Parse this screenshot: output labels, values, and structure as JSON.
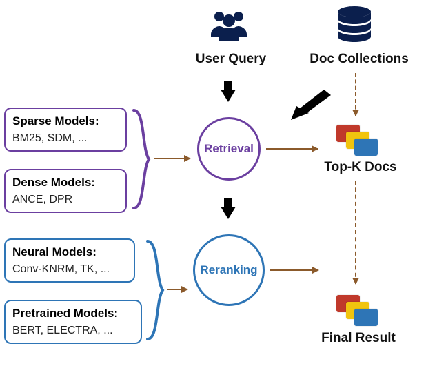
{
  "diagram": {
    "top": {
      "user_query_label": "User Query",
      "doc_collections_label": "Doc Collections"
    },
    "stages": {
      "retrieval": "Retrieval",
      "reranking": "Reranking"
    },
    "outputs": {
      "topk": "Top-K Docs",
      "final": "Final Result"
    },
    "models": {
      "sparse": {
        "title": "Sparse Models:",
        "items": "BM25, SDM, ..."
      },
      "dense": {
        "title": "Dense Models:",
        "items": "ANCE, DPR"
      },
      "neural": {
        "title": "Neural Models:",
        "items": "Conv-KNRM, TK, ..."
      },
      "pretrained": {
        "title": "Pretrained Models:",
        "items": "BERT, ELECTRA, ..."
      }
    },
    "icons": {
      "people": "people-icon",
      "database": "database-icon",
      "doc_stack": "doc-stack"
    },
    "colors": {
      "purple": "#6b3fa0",
      "blue": "#2e75b6",
      "brown": "#8b5a2b",
      "doc_red": "#c0392b",
      "doc_yellow": "#f1c40f",
      "doc_blue": "#2e75b6",
      "db_navy": "#0b1f4d"
    }
  },
  "chart_data": {
    "type": "diagram",
    "title": "",
    "nodes": [
      {
        "id": "user_query",
        "label": "User Query",
        "kind": "source"
      },
      {
        "id": "doc_collections",
        "label": "Doc Collections",
        "kind": "source"
      },
      {
        "id": "retrieval",
        "label": "Retrieval",
        "kind": "stage",
        "color": "purple"
      },
      {
        "id": "reranking",
        "label": "Reranking",
        "kind": "stage",
        "color": "blue"
      },
      {
        "id": "topk",
        "label": "Top-K Docs",
        "kind": "output"
      },
      {
        "id": "final",
        "label": "Final Result",
        "kind": "output"
      },
      {
        "id": "sparse_models",
        "label": "Sparse Models: BM25, SDM, ...",
        "kind": "model-group",
        "color": "purple"
      },
      {
        "id": "dense_models",
        "label": "Dense Models: ANCE, DPR",
        "kind": "model-group",
        "color": "purple"
      },
      {
        "id": "neural_models",
        "label": "Neural Models: Conv-KNRM, TK, ...",
        "kind": "model-group",
        "color": "blue"
      },
      {
        "id": "pretrained_models",
        "label": "Pretrained Models: BERT, ELECTRA, ...",
        "kind": "model-group",
        "color": "blue"
      }
    ],
    "edges": [
      {
        "from": "user_query",
        "to": "retrieval",
        "style": "solid-thick"
      },
      {
        "from": "doc_collections",
        "to": "retrieval",
        "style": "solid-thick"
      },
      {
        "from": "doc_collections",
        "to": "topk",
        "style": "dashed"
      },
      {
        "from": "retrieval",
        "to": "topk",
        "style": "solid-thin"
      },
      {
        "from": "retrieval",
        "to": "reranking",
        "style": "solid-thick"
      },
      {
        "from": "topk",
        "to": "final",
        "style": "dashed"
      },
      {
        "from": "reranking",
        "to": "final",
        "style": "solid-thin"
      },
      {
        "from": "sparse_models",
        "to": "retrieval",
        "style": "brace"
      },
      {
        "from": "dense_models",
        "to": "retrieval",
        "style": "brace"
      },
      {
        "from": "neural_models",
        "to": "reranking",
        "style": "brace"
      },
      {
        "from": "pretrained_models",
        "to": "reranking",
        "style": "brace"
      }
    ]
  }
}
